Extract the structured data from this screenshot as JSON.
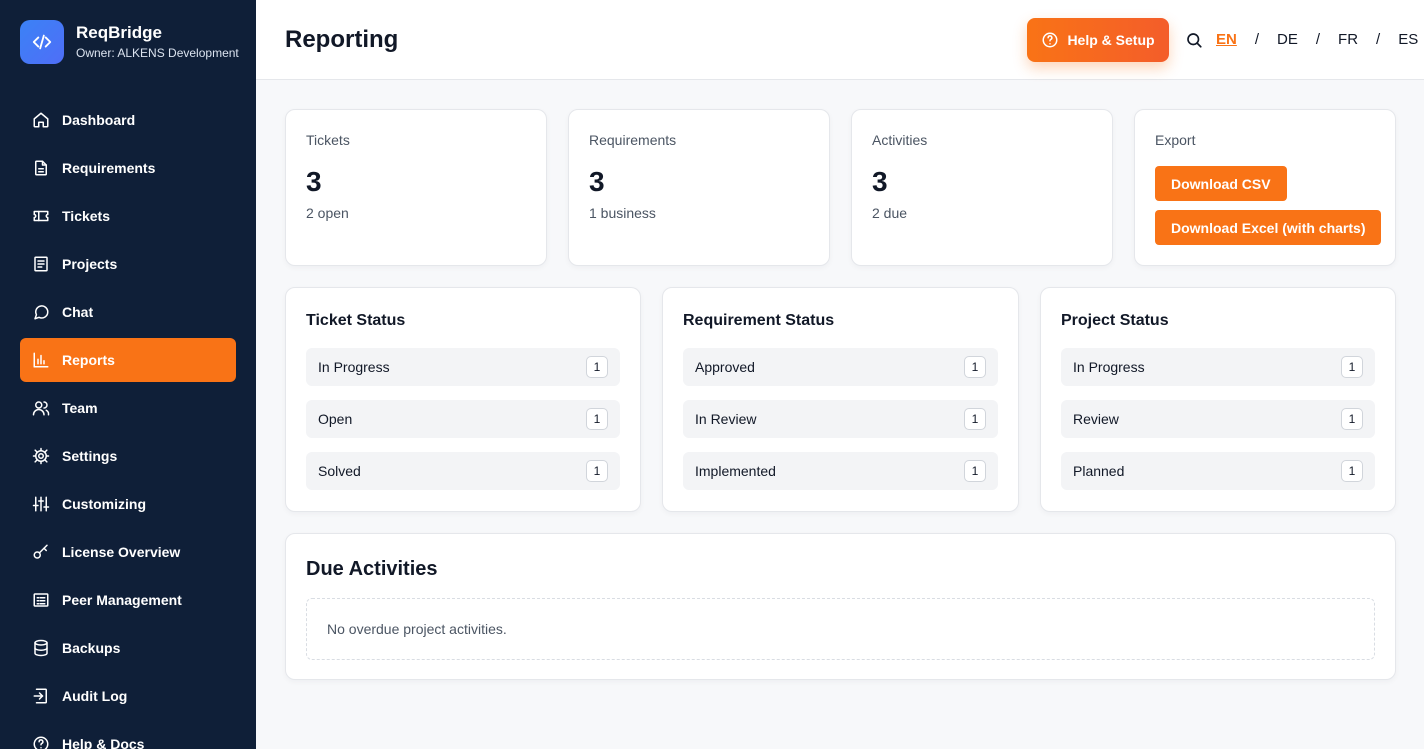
{
  "brand": {
    "name": "ReqBridge",
    "owner": "Owner: ALKENS Development",
    "logo_icon": "code-icon"
  },
  "sidebar": {
    "items": [
      {
        "label": "Dashboard",
        "icon": "home-icon",
        "active": false
      },
      {
        "label": "Requirements",
        "icon": "document-icon",
        "active": false
      },
      {
        "label": "Tickets",
        "icon": "ticket-icon",
        "active": false
      },
      {
        "label": "Projects",
        "icon": "list-icon",
        "active": false
      },
      {
        "label": "Chat",
        "icon": "chat-icon",
        "active": false
      },
      {
        "label": "Reports",
        "icon": "bar-chart-icon",
        "active": true
      },
      {
        "label": "Team",
        "icon": "users-icon",
        "active": false
      },
      {
        "label": "Settings",
        "icon": "gear-icon",
        "active": false
      },
      {
        "label": "Customizing",
        "icon": "sliders-icon",
        "active": false
      },
      {
        "label": "License Overview",
        "icon": "key-icon",
        "active": false
      },
      {
        "label": "Peer Management",
        "icon": "network-icon",
        "active": false
      },
      {
        "label": "Backups",
        "icon": "database-icon",
        "active": false
      },
      {
        "label": "Audit Log",
        "icon": "log-in-icon",
        "active": false
      },
      {
        "label": "Help & Docs",
        "icon": "help-circle-icon",
        "active": false
      }
    ]
  },
  "header": {
    "title": "Reporting",
    "help_button": "Help & Setup",
    "languages": [
      "EN",
      "DE",
      "FR",
      "ES"
    ],
    "active_language": "EN",
    "language_separator": "/"
  },
  "stats": {
    "tickets": {
      "label": "Tickets",
      "value": "3",
      "sub": "2 open"
    },
    "requirements": {
      "label": "Requirements",
      "value": "3",
      "sub": "1 business"
    },
    "activities": {
      "label": "Activities",
      "value": "3",
      "sub": "2 due"
    }
  },
  "export": {
    "label": "Export",
    "csv_button": "Download CSV",
    "excel_button": "Download Excel (with charts)"
  },
  "ticket_status": {
    "title": "Ticket Status",
    "rows": [
      {
        "name": "In Progress",
        "count": "1"
      },
      {
        "name": "Open",
        "count": "1"
      },
      {
        "name": "Solved",
        "count": "1"
      }
    ]
  },
  "requirement_status": {
    "title": "Requirement Status",
    "rows": [
      {
        "name": "Approved",
        "count": "1"
      },
      {
        "name": "In Review",
        "count": "1"
      },
      {
        "name": "Implemented",
        "count": "1"
      }
    ]
  },
  "project_status": {
    "title": "Project Status",
    "rows": [
      {
        "name": "In Progress",
        "count": "1"
      },
      {
        "name": "Review",
        "count": "1"
      },
      {
        "name": "Planned",
        "count": "1"
      }
    ]
  },
  "due_activities": {
    "title": "Due Activities",
    "empty_text": "No overdue project activities."
  },
  "colors": {
    "sidebar_bg": "#0f1f38",
    "accent": "#f97316",
    "brand_logo": "#3b82f6",
    "page_bg": "#f7f8fa"
  }
}
